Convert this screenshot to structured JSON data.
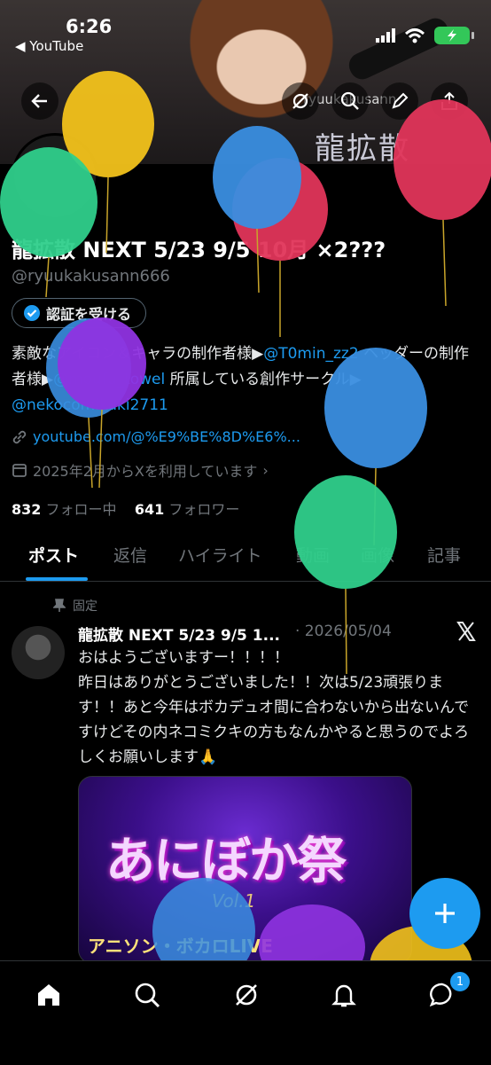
{
  "status_bar": {
    "time": "6:26",
    "back_app": "◀ YouTube"
  },
  "banner": {
    "logo_sub": "ryuukakusann",
    "logo_kanji": "龍拡散"
  },
  "profile": {
    "name": "龍拡散 NEXT 5/23 9/5 10月 ×2???",
    "handle": "@ryuukakusann666",
    "verify_label": "認証を受ける",
    "bio_1": "素敵な",
    "bio_2": "アイコン＆キャラの制作者様▶",
    "bio_link_1": "@T0min_zz2",
    "bio_3": " ヘッダーの制作者様▶",
    "bio_link_2": "@moufu_towel",
    "bio_4": " 所属している創作サークル▶ ",
    "bio_link_3": "@nekocomikuki2711",
    "url": "youtube.com/@%E9%BE%8D%E6%...",
    "joined": "2025年2月からXを利用しています",
    "following_count": "832",
    "following_label": "フォロー中",
    "followers_count": "641",
    "followers_label": "フォロワー"
  },
  "tabs": [
    "ポスト",
    "返信",
    "ハイライト",
    "動画",
    "画像",
    "記事"
  ],
  "post": {
    "pinned_label": "固定",
    "author": "龍拡散 NEXT 5/23 9/5 1...",
    "date": "· 2026/05/04",
    "text_1": "おはようございますー！！！！",
    "text_2": "昨日はありがとうございました！！次は5/23頑張ります！！あと今年はボカデュオ間に合わないから出ないんですけどその内ネコミクキの方もなんかやると思うのでよろしくお願いします🙏",
    "image_title": "あにぼか祭",
    "image_vol": "Vol.1",
    "image_sub": "アニソン・ボカロLIVE"
  },
  "bottom_nav": {
    "badge_count": "1"
  },
  "colors": {
    "accent": "#1d9bf0",
    "bg": "#000000",
    "muted": "#71767b"
  }
}
